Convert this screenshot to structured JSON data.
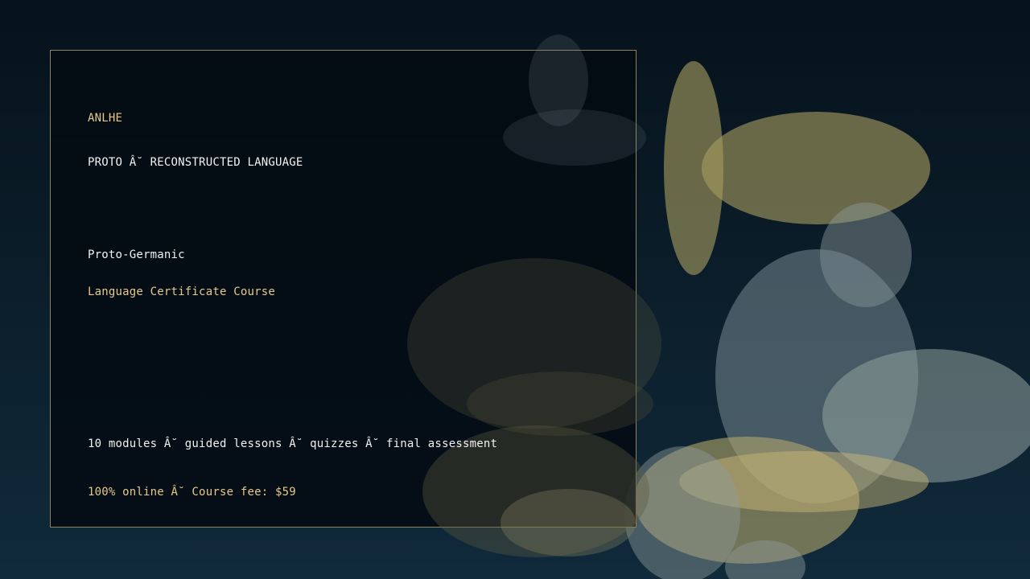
{
  "card": {
    "brand": "ANLHE",
    "subtitle": "PROTO Â˘ RECONSTRUCTED LANGUAGE",
    "title": "Proto-Germanic",
    "course_type": "Language Certificate Course",
    "modules_line": "10 modules Â˘ guided lessons Â˘ quizzes Â˘ final assessment",
    "fee_line": "100% online Â˘ Course fee: $59"
  },
  "colors": {
    "gold_accent": "#e6c98a",
    "text_white": "#f2f2f2",
    "card_border": "#8a8460",
    "bubble_gold": "#a59b5f",
    "bubble_gray": "#7f9199"
  }
}
